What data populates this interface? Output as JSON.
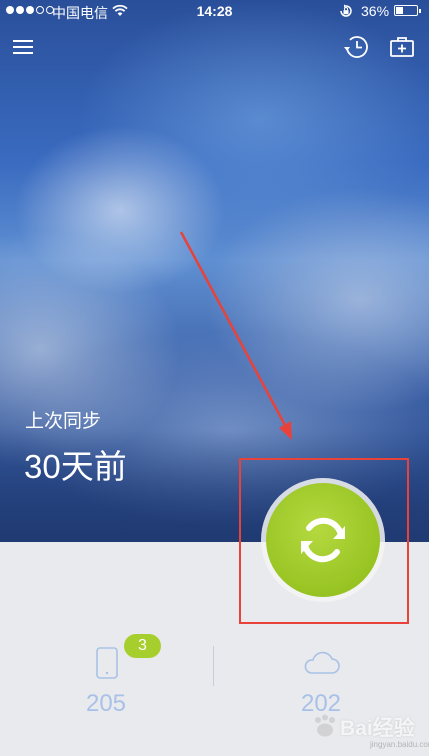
{
  "status_bar": {
    "carrier": "中国电信",
    "time": "14:28",
    "battery_percent": "36%",
    "battery_level": 0.36,
    "signal_bars": 3,
    "signal_total": 5
  },
  "toolbar": {
    "menu_icon": "hamburger-menu-icon",
    "history_icon": "history-clock-icon",
    "toolkit_icon": "toolkit-case-icon"
  },
  "sync": {
    "last_sync_label": "上次同步",
    "last_sync_value": "30天前",
    "button_icon": "refresh-arrows-icon",
    "button_color": "#9bc62a"
  },
  "stats": {
    "phone_count": "205",
    "phone_badge": "3",
    "cloud_count": "202",
    "accent_color": "#a9c1e6",
    "badge_color": "#a6cf2e"
  },
  "annotation": {
    "box_color": "#e8423a"
  },
  "watermark": {
    "text": "Bai经验",
    "sub": "jingyan.baidu.com"
  }
}
